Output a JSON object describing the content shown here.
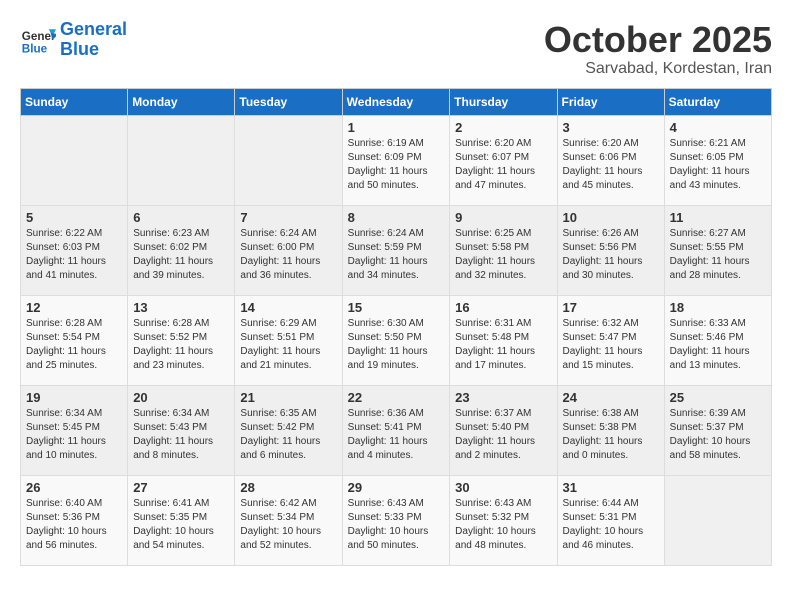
{
  "header": {
    "logo_line1": "General",
    "logo_line2": "Blue",
    "month": "October 2025",
    "location": "Sarvabad, Kordestan, Iran"
  },
  "weekdays": [
    "Sunday",
    "Monday",
    "Tuesday",
    "Wednesday",
    "Thursday",
    "Friday",
    "Saturday"
  ],
  "weeks": [
    [
      {
        "num": "",
        "sunrise": "",
        "sunset": "",
        "daylight": ""
      },
      {
        "num": "",
        "sunrise": "",
        "sunset": "",
        "daylight": ""
      },
      {
        "num": "",
        "sunrise": "",
        "sunset": "",
        "daylight": ""
      },
      {
        "num": "1",
        "sunrise": "Sunrise: 6:19 AM",
        "sunset": "Sunset: 6:09 PM",
        "daylight": "Daylight: 11 hours and 50 minutes."
      },
      {
        "num": "2",
        "sunrise": "Sunrise: 6:20 AM",
        "sunset": "Sunset: 6:07 PM",
        "daylight": "Daylight: 11 hours and 47 minutes."
      },
      {
        "num": "3",
        "sunrise": "Sunrise: 6:20 AM",
        "sunset": "Sunset: 6:06 PM",
        "daylight": "Daylight: 11 hours and 45 minutes."
      },
      {
        "num": "4",
        "sunrise": "Sunrise: 6:21 AM",
        "sunset": "Sunset: 6:05 PM",
        "daylight": "Daylight: 11 hours and 43 minutes."
      }
    ],
    [
      {
        "num": "5",
        "sunrise": "Sunrise: 6:22 AM",
        "sunset": "Sunset: 6:03 PM",
        "daylight": "Daylight: 11 hours and 41 minutes."
      },
      {
        "num": "6",
        "sunrise": "Sunrise: 6:23 AM",
        "sunset": "Sunset: 6:02 PM",
        "daylight": "Daylight: 11 hours and 39 minutes."
      },
      {
        "num": "7",
        "sunrise": "Sunrise: 6:24 AM",
        "sunset": "Sunset: 6:00 PM",
        "daylight": "Daylight: 11 hours and 36 minutes."
      },
      {
        "num": "8",
        "sunrise": "Sunrise: 6:24 AM",
        "sunset": "Sunset: 5:59 PM",
        "daylight": "Daylight: 11 hours and 34 minutes."
      },
      {
        "num": "9",
        "sunrise": "Sunrise: 6:25 AM",
        "sunset": "Sunset: 5:58 PM",
        "daylight": "Daylight: 11 hours and 32 minutes."
      },
      {
        "num": "10",
        "sunrise": "Sunrise: 6:26 AM",
        "sunset": "Sunset: 5:56 PM",
        "daylight": "Daylight: 11 hours and 30 minutes."
      },
      {
        "num": "11",
        "sunrise": "Sunrise: 6:27 AM",
        "sunset": "Sunset: 5:55 PM",
        "daylight": "Daylight: 11 hours and 28 minutes."
      }
    ],
    [
      {
        "num": "12",
        "sunrise": "Sunrise: 6:28 AM",
        "sunset": "Sunset: 5:54 PM",
        "daylight": "Daylight: 11 hours and 25 minutes."
      },
      {
        "num": "13",
        "sunrise": "Sunrise: 6:28 AM",
        "sunset": "Sunset: 5:52 PM",
        "daylight": "Daylight: 11 hours and 23 minutes."
      },
      {
        "num": "14",
        "sunrise": "Sunrise: 6:29 AM",
        "sunset": "Sunset: 5:51 PM",
        "daylight": "Daylight: 11 hours and 21 minutes."
      },
      {
        "num": "15",
        "sunrise": "Sunrise: 6:30 AM",
        "sunset": "Sunset: 5:50 PM",
        "daylight": "Daylight: 11 hours and 19 minutes."
      },
      {
        "num": "16",
        "sunrise": "Sunrise: 6:31 AM",
        "sunset": "Sunset: 5:48 PM",
        "daylight": "Daylight: 11 hours and 17 minutes."
      },
      {
        "num": "17",
        "sunrise": "Sunrise: 6:32 AM",
        "sunset": "Sunset: 5:47 PM",
        "daylight": "Daylight: 11 hours and 15 minutes."
      },
      {
        "num": "18",
        "sunrise": "Sunrise: 6:33 AM",
        "sunset": "Sunset: 5:46 PM",
        "daylight": "Daylight: 11 hours and 13 minutes."
      }
    ],
    [
      {
        "num": "19",
        "sunrise": "Sunrise: 6:34 AM",
        "sunset": "Sunset: 5:45 PM",
        "daylight": "Daylight: 11 hours and 10 minutes."
      },
      {
        "num": "20",
        "sunrise": "Sunrise: 6:34 AM",
        "sunset": "Sunset: 5:43 PM",
        "daylight": "Daylight: 11 hours and 8 minutes."
      },
      {
        "num": "21",
        "sunrise": "Sunrise: 6:35 AM",
        "sunset": "Sunset: 5:42 PM",
        "daylight": "Daylight: 11 hours and 6 minutes."
      },
      {
        "num": "22",
        "sunrise": "Sunrise: 6:36 AM",
        "sunset": "Sunset: 5:41 PM",
        "daylight": "Daylight: 11 hours and 4 minutes."
      },
      {
        "num": "23",
        "sunrise": "Sunrise: 6:37 AM",
        "sunset": "Sunset: 5:40 PM",
        "daylight": "Daylight: 11 hours and 2 minutes."
      },
      {
        "num": "24",
        "sunrise": "Sunrise: 6:38 AM",
        "sunset": "Sunset: 5:38 PM",
        "daylight": "Daylight: 11 hours and 0 minutes."
      },
      {
        "num": "25",
        "sunrise": "Sunrise: 6:39 AM",
        "sunset": "Sunset: 5:37 PM",
        "daylight": "Daylight: 10 hours and 58 minutes."
      }
    ],
    [
      {
        "num": "26",
        "sunrise": "Sunrise: 6:40 AM",
        "sunset": "Sunset: 5:36 PM",
        "daylight": "Daylight: 10 hours and 56 minutes."
      },
      {
        "num": "27",
        "sunrise": "Sunrise: 6:41 AM",
        "sunset": "Sunset: 5:35 PM",
        "daylight": "Daylight: 10 hours and 54 minutes."
      },
      {
        "num": "28",
        "sunrise": "Sunrise: 6:42 AM",
        "sunset": "Sunset: 5:34 PM",
        "daylight": "Daylight: 10 hours and 52 minutes."
      },
      {
        "num": "29",
        "sunrise": "Sunrise: 6:43 AM",
        "sunset": "Sunset: 5:33 PM",
        "daylight": "Daylight: 10 hours and 50 minutes."
      },
      {
        "num": "30",
        "sunrise": "Sunrise: 6:43 AM",
        "sunset": "Sunset: 5:32 PM",
        "daylight": "Daylight: 10 hours and 48 minutes."
      },
      {
        "num": "31",
        "sunrise": "Sunrise: 6:44 AM",
        "sunset": "Sunset: 5:31 PM",
        "daylight": "Daylight: 10 hours and 46 minutes."
      },
      {
        "num": "",
        "sunrise": "",
        "sunset": "",
        "daylight": ""
      }
    ]
  ]
}
